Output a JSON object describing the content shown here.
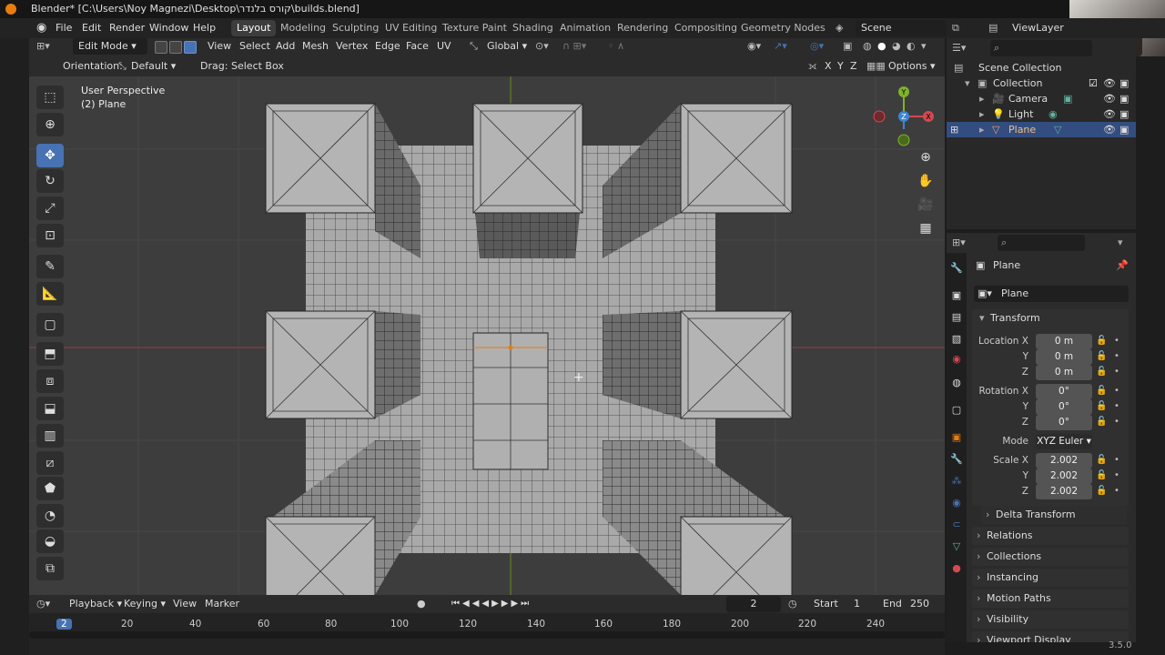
{
  "title": "Blender* [C:\\Users\\Noy Magnezi\\Desktop\\קורס בלנדר\\builds.blend]",
  "menu": [
    "File",
    "Edit",
    "Render",
    "Window",
    "Help"
  ],
  "workspaces": [
    "Layout",
    "Modeling",
    "Sculpting",
    "UV Editing",
    "Texture Paint",
    "Shading",
    "Animation",
    "Rendering",
    "Compositing",
    "Geometry Nodes"
  ],
  "active_workspace": "Layout",
  "scene": "Scene",
  "view_layer": "ViewLayer",
  "viewport_header": {
    "mode": "Edit Mode",
    "menus": [
      "View",
      "Select",
      "Add",
      "Mesh",
      "Vertex",
      "Edge",
      "Face",
      "UV"
    ],
    "transform_orientation": "Global"
  },
  "tool_header": {
    "orientation_label": "Orientation:",
    "orientation_value": "Default",
    "drag_label": "Drag:",
    "drag_value": "Select Box",
    "axes": [
      "X",
      "Y",
      "Z"
    ],
    "options": "Options"
  },
  "overlay": {
    "line1": "User Perspective",
    "line2": "(2) Plane"
  },
  "gizmo_axes": {
    "x": "X",
    "y": "Y",
    "z": "Z"
  },
  "timeline": {
    "menus": [
      "Playback",
      "Keying",
      "View",
      "Marker"
    ],
    "current_frame": "2",
    "start_label": "Start",
    "start": "1",
    "end_label": "End",
    "end": "250",
    "ruler": [
      "2",
      "20",
      "40",
      "60",
      "80",
      "100",
      "120",
      "140",
      "160",
      "180",
      "200",
      "220",
      "240"
    ]
  },
  "outliner": {
    "root": "Scene Collection",
    "collection": "Collection",
    "items": [
      {
        "name": "Camera",
        "selected": false
      },
      {
        "name": "Light",
        "selected": false
      },
      {
        "name": "Plane",
        "selected": true
      }
    ]
  },
  "properties": {
    "object_name": "Plane",
    "object_field": "Plane",
    "transform_label": "Transform",
    "location_label": "Location X",
    "location": [
      "0 m",
      "0 m",
      "0 m"
    ],
    "rotation_label": "Rotation X",
    "rotation": [
      "0°",
      "0°",
      "0°"
    ],
    "mode_label": "Mode",
    "mode_value": "XYZ Euler",
    "scale_label": "Scale X",
    "scale": [
      "2.002",
      "2.002",
      "2.002"
    ],
    "axis_y": "Y",
    "axis_z": "Z",
    "subsections": [
      "Delta Transform"
    ],
    "sections": [
      "Relations",
      "Collections",
      "Instancing",
      "Motion Paths",
      "Visibility",
      "Viewport Display"
    ]
  },
  "version": "3.5.0",
  "colors": {
    "accent": "#4772b3",
    "x_axis": "#d44850",
    "y_axis": "#7fb32a",
    "z_axis": "#3a86d6",
    "highlight": "#e87d0d"
  }
}
